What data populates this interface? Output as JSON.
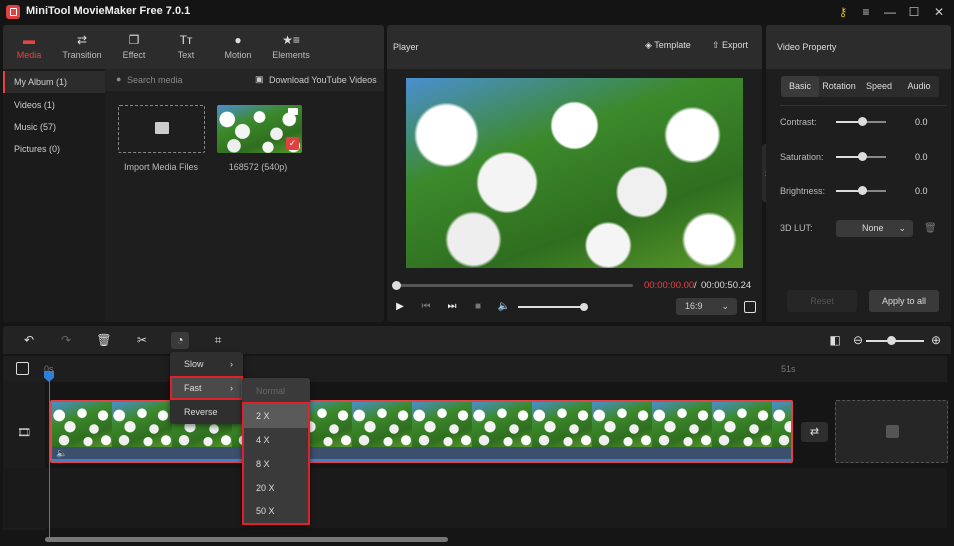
{
  "app": {
    "title": "MiniTool MovieMaker Free 7.0.1"
  },
  "window_controls": [
    "key-icon",
    "menu-icon",
    "minimize-icon",
    "maximize-icon",
    "close-icon"
  ],
  "toolbar": {
    "tabs": [
      {
        "label": "Media",
        "icon": "folder-icon",
        "active": true
      },
      {
        "label": "Transition",
        "icon": "swap-icon"
      },
      {
        "label": "Effect",
        "icon": "layers-icon"
      },
      {
        "label": "Text",
        "icon": "text-icon"
      },
      {
        "label": "Motion",
        "icon": "motion-icon"
      },
      {
        "label": "Elements",
        "icon": "star-list-icon"
      }
    ]
  },
  "media": {
    "nav": [
      {
        "label": "My Album (1)",
        "active": true
      },
      {
        "label": "Videos (1)"
      },
      {
        "label": "Music (57)"
      },
      {
        "label": "Pictures (0)"
      }
    ],
    "search_placeholder": "Search media",
    "download_label": "Download YouTube Videos",
    "import_label": "Import Media Files",
    "clip_label": "168572 (540p)"
  },
  "player": {
    "title": "Player",
    "template_label": "Template",
    "export_label": "Export",
    "time_current": "00:00:00.00",
    "time_separator": " / ",
    "time_total": "00:00:50.24",
    "aspect_ratio": "16:9",
    "progress": 0.0,
    "volume": 1.0
  },
  "properties": {
    "title": "Video Property",
    "tabs": [
      "Basic",
      "Rotation",
      "Speed",
      "Audio"
    ],
    "active_tab": "Basic",
    "sliders": [
      {
        "label": "Contrast:",
        "value": "0.0"
      },
      {
        "label": "Saturation:",
        "value": "0.0"
      },
      {
        "label": "Brightness:",
        "value": "0.0"
      }
    ],
    "lut_label": "3D LUT:",
    "lut_value": "None",
    "reset_label": "Reset",
    "apply_label": "Apply to all"
  },
  "timeline": {
    "ruler_start": "0s",
    "ruler_end": "51s",
    "zoom_level": 0.5
  },
  "speed_menu": {
    "items": [
      {
        "label": "Slow",
        "arrow": "›"
      },
      {
        "label": "Fast",
        "arrow": "›",
        "highlighted": true
      },
      {
        "label": "Reverse"
      }
    ],
    "fast_submenu": {
      "normal": "Normal",
      "options": [
        "2 X",
        "4 X",
        "8 X",
        "20 X",
        "50 X"
      ],
      "selected": "2 X"
    }
  },
  "colors": {
    "accent": "#e8433f",
    "playhead": "#2f7fd8",
    "highlight_border": "#e0202a"
  }
}
